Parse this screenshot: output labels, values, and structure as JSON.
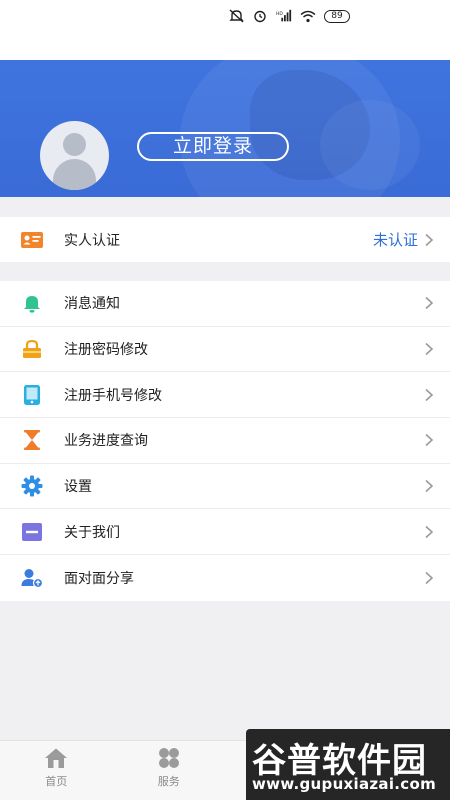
{
  "status_bar": {
    "battery": "89",
    "icons": [
      "mute-icon",
      "alarm-icon",
      "hd-signal-icon",
      "wifi-icon",
      "battery-icon"
    ]
  },
  "profile": {
    "login_label": "立即登录"
  },
  "verify": {
    "label": "实人认证",
    "value": "未认证",
    "icon": "id-card-icon"
  },
  "menu": {
    "items": [
      {
        "label": "消息通知",
        "icon": "bell-icon"
      },
      {
        "label": "注册密码修改",
        "icon": "lock-icon"
      },
      {
        "label": "注册手机号修改",
        "icon": "phone-icon"
      },
      {
        "label": "业务进度查询",
        "icon": "hourglass-icon"
      },
      {
        "label": "设置",
        "icon": "gear-icon"
      },
      {
        "label": "关于我们",
        "icon": "minus-box-icon"
      },
      {
        "label": "面对面分享",
        "icon": "share-user-icon"
      }
    ]
  },
  "tabbar": {
    "tabs": [
      {
        "label": "首页",
        "icon": "home-icon"
      },
      {
        "label": "服务",
        "icon": "grid-icon"
      }
    ]
  },
  "watermark": {
    "title": "谷普软件园",
    "url": "www.gupuxiazai.com"
  },
  "colors": {
    "accent": "#3a6bd6",
    "verify_value": "#2e6fd8",
    "bell": "#2fc48d",
    "lock": "#f2a218",
    "phone": "#2ab0e0",
    "hourglass": "#f07c2a",
    "gear": "#2f8fe6",
    "about": "#7c74e0",
    "share": "#3b7ddf"
  }
}
